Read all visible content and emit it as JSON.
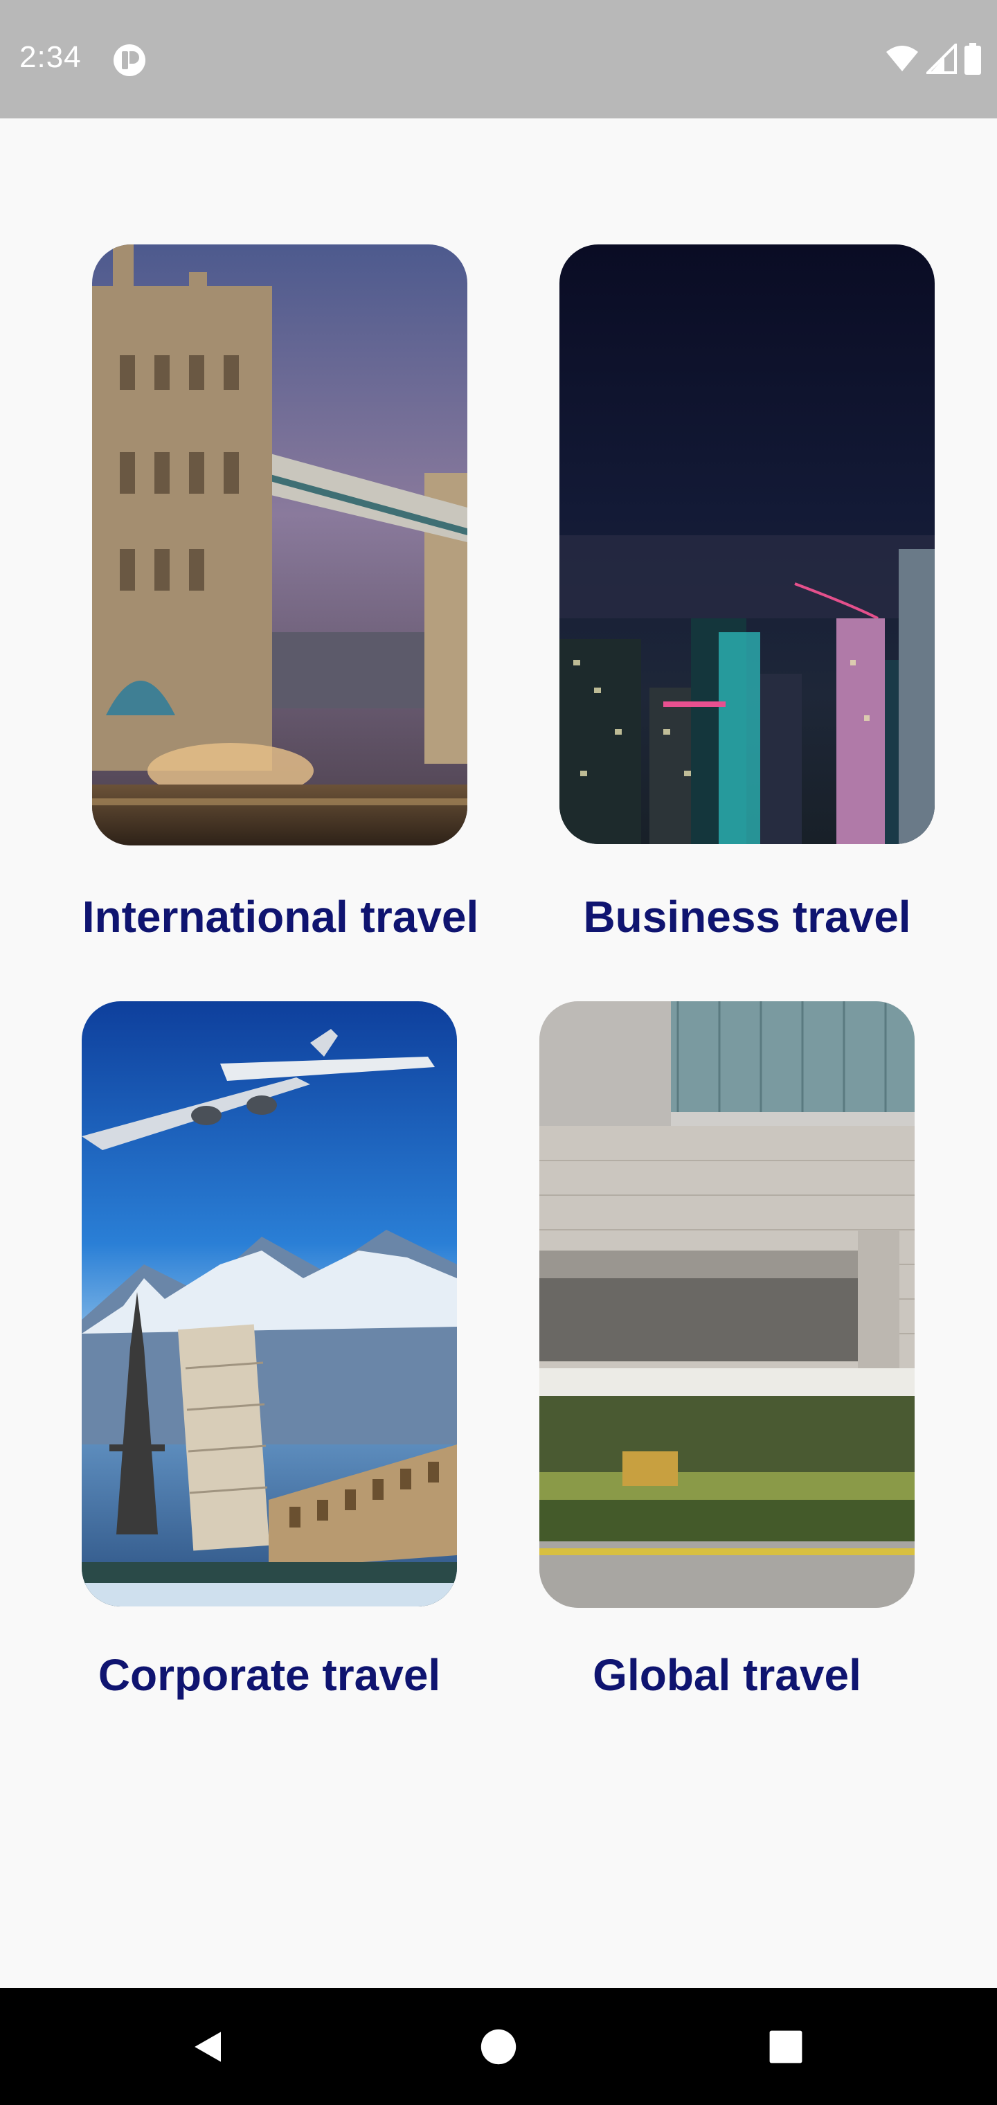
{
  "status_bar": {
    "time": "2:34",
    "icons": [
      "app-notification-icon",
      "wifi-icon",
      "signal-icon",
      "battery-icon"
    ]
  },
  "cards": [
    {
      "label": "International travel",
      "image": "tower-bridge-photo"
    },
    {
      "label": "Business travel",
      "image": "night-city-skyline-photo"
    },
    {
      "label": "Corporate travel",
      "image": "airplane-landmarks-photo"
    },
    {
      "label": "Global travel",
      "image": "office-building-photo"
    }
  ],
  "nav_bar": {
    "buttons": [
      "back-icon",
      "home-icon",
      "recents-icon"
    ]
  },
  "colors": {
    "status_bar_bg": "#b8b8b8",
    "page_bg": "#f9f9f9",
    "label_color": "#0f1470",
    "nav_bar_bg": "#000000"
  }
}
